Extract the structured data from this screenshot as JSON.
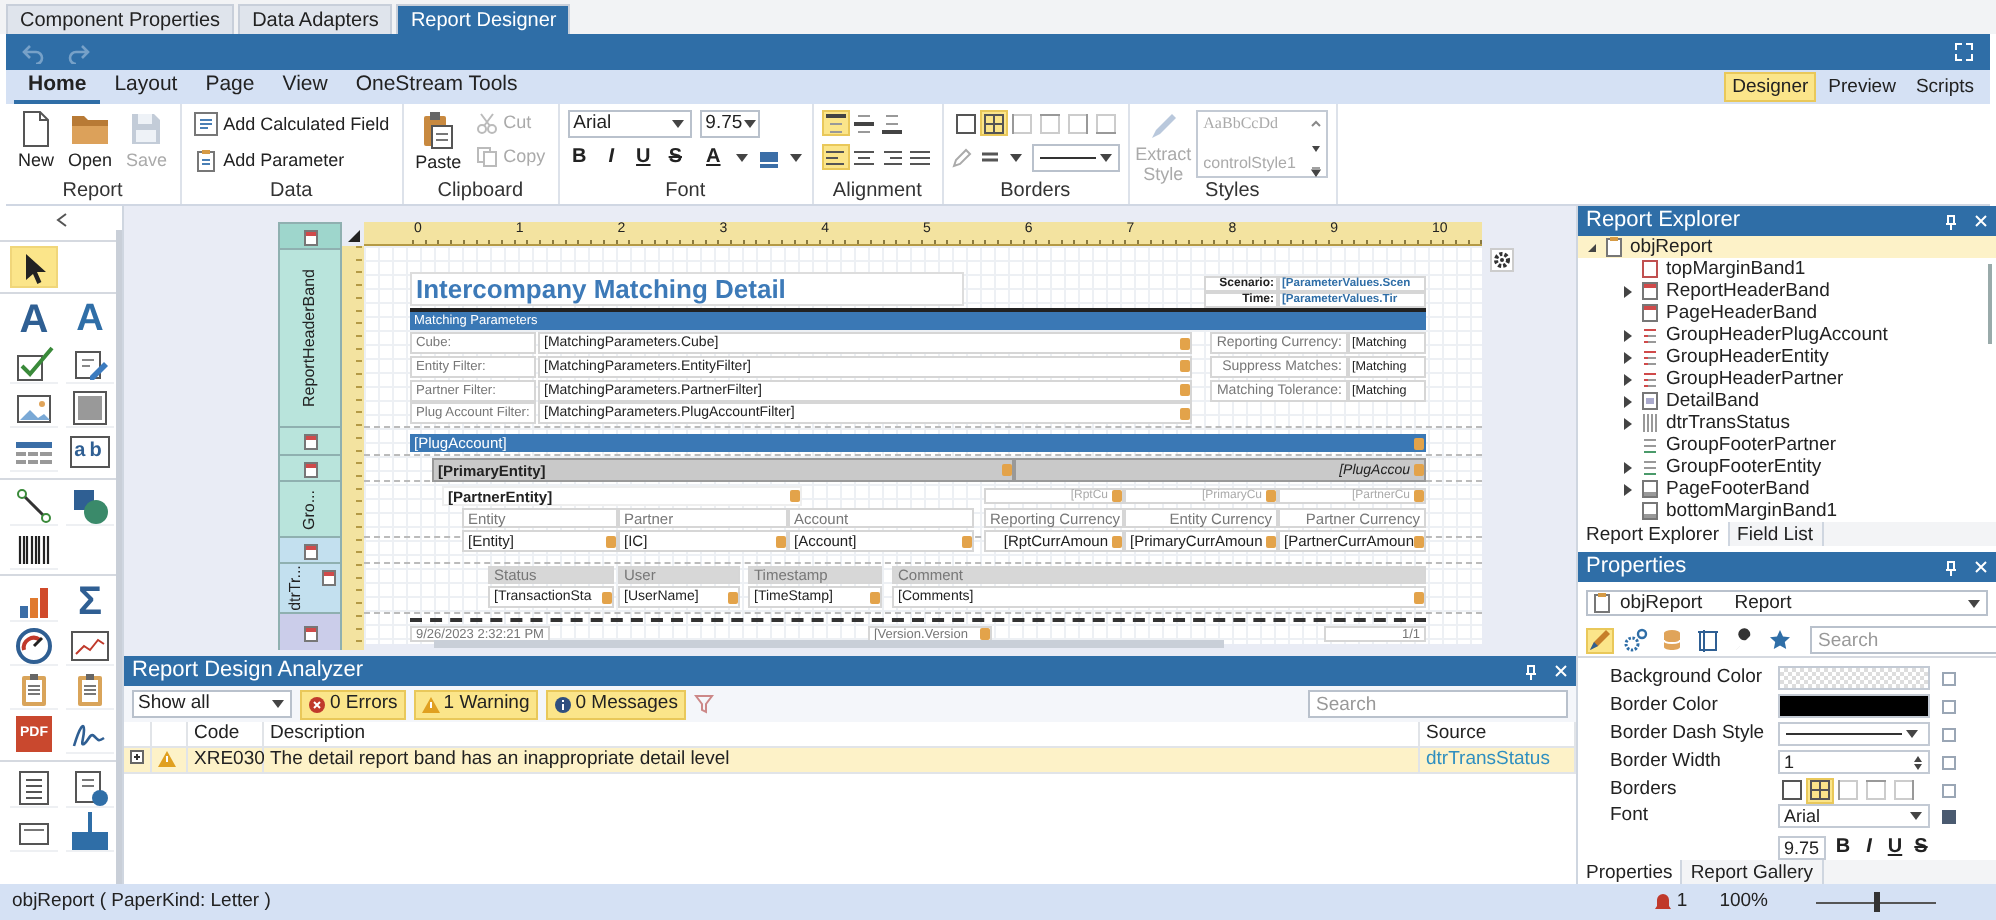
{
  "top_tabs": [
    {
      "label": "Component Properties",
      "selected": false
    },
    {
      "label": "Data Adapters",
      "selected": false
    },
    {
      "label": "Report Designer",
      "selected": true
    }
  ],
  "quick_access": [
    {
      "kind": "undo",
      "disabled": true
    },
    {
      "kind": "redo",
      "disabled": true
    }
  ],
  "ribbon": {
    "tabs": [
      {
        "label": "Home",
        "selected": true
      },
      {
        "label": "Layout",
        "selected": false
      },
      {
        "label": "Page",
        "selected": false
      },
      {
        "label": "View",
        "selected": false
      },
      {
        "label": "OneStream Tools",
        "selected": false
      }
    ],
    "modes": [
      {
        "label": "Designer",
        "selected": true
      },
      {
        "label": "Preview",
        "selected": false
      },
      {
        "label": "Scripts",
        "selected": false
      }
    ],
    "report_group": {
      "label": "Report",
      "buttons": [
        {
          "kind": "new",
          "label": "New",
          "disabled": false
        },
        {
          "kind": "open",
          "label": "Open",
          "disabled": false
        },
        {
          "kind": "save",
          "label": "Save",
          "disabled": true
        }
      ]
    },
    "data_group": {
      "label": "Data",
      "buttons": [
        {
          "kind": "calc",
          "label": "Add Calculated Field"
        },
        {
          "kind": "param",
          "label": "Add Parameter"
        }
      ]
    },
    "clipboard_group": {
      "label": "Clipboard",
      "paste": "Paste",
      "buttons": [
        {
          "kind": "cut",
          "label": "Cut",
          "disabled": true
        },
        {
          "kind": "copy",
          "label": "Copy",
          "disabled": true
        }
      ]
    },
    "font_group": {
      "label": "Font",
      "font": "Arial",
      "size": "9.75",
      "styles": [
        "B",
        "I",
        "U",
        "S"
      ],
      "color_glyph": "A"
    },
    "alignment_group": {
      "label": "Alignment",
      "rows": [
        [
          {
            "kind": "top",
            "selected": true
          },
          {
            "kind": "middle",
            "selected": false
          },
          {
            "kind": "bottom",
            "selected": false
          }
        ],
        [
          {
            "kind": "left",
            "selected": true
          },
          {
            "kind": "center",
            "selected": false
          },
          {
            "kind": "right",
            "selected": false
          },
          {
            "kind": "justify",
            "selected": false
          }
        ]
      ]
    },
    "borders_group": {
      "label": "Borders",
      "buttons": [
        {
          "kind": "none",
          "selected": false
        },
        {
          "kind": "all",
          "selected": true
        },
        {
          "kind": "left",
          "selected": false
        },
        {
          "kind": "top",
          "selected": false
        },
        {
          "kind": "right",
          "selected": false
        },
        {
          "kind": "bottom",
          "selected": false
        }
      ]
    },
    "styles_group": {
      "label": "Styles",
      "extract": {
        "label": "Extract Style",
        "disabled": true
      },
      "previews": [
        "AaBbCcDd",
        "controlStyle1"
      ]
    }
  },
  "toolbox": {
    "groups": [
      [
        {
          "kind": "pointer",
          "selected": true
        }
      ],
      [
        {
          "kind": "label",
          "glyph": "A",
          "selected": false
        },
        {
          "kind": "richtext",
          "glyph": "A",
          "selected": false
        },
        {
          "kind": "checkedit",
          "selected": false
        },
        {
          "kind": "edit",
          "selected": false
        },
        {
          "kind": "picture",
          "selected": false
        },
        {
          "kind": "panel",
          "selected": false
        },
        {
          "kind": "table",
          "selected": false
        },
        {
          "kind": "charbox",
          "glyph": "ab",
          "selected": false
        }
      ],
      [
        {
          "kind": "line",
          "selected": false
        },
        {
          "kind": "shape",
          "selected": false
        },
        {
          "kind": "barcode",
          "selected": false
        }
      ],
      [
        {
          "kind": "chart",
          "selected": false
        },
        {
          "kind": "sum",
          "glyph": "Σ",
          "selected": false
        },
        {
          "kind": "gauge",
          "selected": false
        },
        {
          "kind": "sparkline",
          "selected": false
        },
        {
          "kind": "subreport",
          "selected": false
        },
        {
          "kind": "subreport",
          "selected": false
        },
        {
          "kind": "pdf",
          "glyph": "PDF",
          "selected": false
        },
        {
          "kind": "signature",
          "selected": false
        }
      ],
      [
        {
          "kind": "toc",
          "selected": false
        },
        {
          "kind": "pageinfo",
          "selected": false
        },
        {
          "kind": "pagebreak",
          "selected": false
        },
        {
          "kind": "crossband",
          "selected": false
        }
      ]
    ]
  },
  "designer": {
    "ruler": [
      "0",
      "1",
      "2",
      "3",
      "4",
      "5",
      "6",
      "7",
      "8",
      "9",
      "10"
    ],
    "bands": [
      {
        "kind": "margin"
      },
      {
        "kind": "header",
        "label": "ReportHeaderBand"
      },
      {
        "kind": "group"
      },
      {
        "kind": "group"
      },
      {
        "kind": "group",
        "label": "Gro..."
      },
      {
        "kind": "detail"
      },
      {
        "kind": "detail-report",
        "label": "dtrTr..."
      },
      {
        "kind": "footer"
      }
    ],
    "report": {
      "title": "Intercompany Matching Detail",
      "header_fields": [
        {
          "label": "Scenario:",
          "value": "[ParameterValues.Scen"
        },
        {
          "label": "Time:",
          "value": "[ParameterValues.Tir"
        }
      ],
      "section_title": "Matching Parameters",
      "params_left": [
        {
          "label": "Cube:",
          "value": "[MatchingParameters.Cube]"
        },
        {
          "label": "Entity Filter:",
          "value": "[MatchingParameters.EntityFilter]"
        },
        {
          "label": "Partner Filter:",
          "value": "[MatchingParameters.PartnerFilter]"
        },
        {
          "label": "Plug Account Filter:",
          "value": "[MatchingParameters.PlugAccountFilter]"
        }
      ],
      "params_right": [
        {
          "label": "Reporting Currency:",
          "value": "[Matching"
        },
        {
          "label": "Suppress Matches:",
          "value": "[Matching"
        },
        {
          "label": "Matching Tolerance:",
          "value": "[Matching"
        }
      ],
      "plug_account": "[PlugAccount]",
      "primary_entity": "[PrimaryEntity]",
      "primary_right": "[PlugAccou",
      "partner_entity": "[PartnerEntity]",
      "group_totals": [
        "[RptCu",
        "[PrimaryCu",
        "[PartnerCu"
      ],
      "detail_headers": [
        "Entity",
        "Partner",
        "Account",
        "Reporting Currency",
        "Entity Currency",
        "Partner Currency"
      ],
      "detail_values": [
        "[Entity]",
        "[IC]",
        "[Account]",
        "[RptCurrAmoun",
        "[PrimaryCurrAmoun",
        "[PartnerCurrAmoun"
      ],
      "status_headers": [
        "Status",
        "User",
        "Timestamp",
        "Comment"
      ],
      "status_values": [
        "[TransactionSta",
        "[UserName]",
        "[TimeStamp]",
        "[Comments]"
      ],
      "footer": [
        "9/26/2023 2:32:21 PM",
        "[Version.Version",
        "1/1"
      ]
    }
  },
  "analyzer": {
    "title": "Report Design Analyzer",
    "filter": "Show all",
    "toggles": [
      {
        "kind": "error",
        "label": "0 Errors",
        "selected": true
      },
      {
        "kind": "warning",
        "label": "1 Warning",
        "selected": true
      },
      {
        "kind": "message",
        "label": "0 Messages",
        "selected": true
      }
    ],
    "search_placeholder": "Search",
    "columns": [
      "Code",
      "Description",
      "Source"
    ],
    "rows": [
      {
        "kind": "warning",
        "code": "XRE030",
        "description": "The detail report band has an inappropriate detail level",
        "source": "dtrTransStatus",
        "selected": true,
        "expanded": false
      }
    ]
  },
  "report_explorer": {
    "title": "Report Explorer",
    "tree": [
      {
        "label": "objReport",
        "kind": "report",
        "expanded": true,
        "selected": true,
        "children": [
          {
            "label": "topMarginBand1",
            "kind": "margin",
            "expandable": false,
            "selected": false
          },
          {
            "label": "ReportHeaderBand",
            "kind": "header",
            "expandable": true,
            "selected": false
          },
          {
            "label": "PageHeaderBand",
            "kind": "header",
            "expandable": false,
            "selected": false
          },
          {
            "label": "GroupHeaderPlugAccount",
            "kind": "group",
            "expandable": true,
            "selected": false
          },
          {
            "label": "GroupHeaderEntity",
            "kind": "group",
            "expandable": true,
            "selected": false
          },
          {
            "label": "GroupHeaderPartner",
            "kind": "group",
            "expandable": true,
            "selected": false
          },
          {
            "label": "DetailBand",
            "kind": "detail",
            "expandable": true,
            "selected": false
          },
          {
            "label": "dtrTransStatus",
            "kind": "detail-report",
            "expandable": true,
            "selected": false
          },
          {
            "label": "GroupFooterPartner",
            "kind": "group-footer",
            "expandable": false,
            "selected": false
          },
          {
            "label": "GroupFooterEntity",
            "kind": "group-footer",
            "expandable": true,
            "selected": false
          },
          {
            "label": "PageFooterBand",
            "kind": "footer",
            "expandable": true,
            "selected": false
          },
          {
            "label": "bottomMarginBand1",
            "kind": "footer",
            "expandable": false,
            "selected": false
          }
        ]
      }
    ],
    "tabs": [
      {
        "label": "Report Explorer",
        "selected": true
      },
      {
        "label": "Field List",
        "selected": false
      }
    ]
  },
  "properties": {
    "title": "Properties",
    "object": "objReport",
    "type": "Report",
    "tools": [
      {
        "kind": "appearance",
        "selected": true
      },
      {
        "kind": "behavior",
        "selected": false
      },
      {
        "kind": "data",
        "selected": false
      },
      {
        "kind": "layout",
        "selected": false
      },
      {
        "kind": "tools",
        "selected": false
      },
      {
        "kind": "favorites",
        "selected": false
      }
    ],
    "search_placeholder": "Search",
    "rows": [
      {
        "label": "Background Color",
        "kind": "transparent",
        "modified": false
      },
      {
        "label": "Border Color",
        "kind": "color",
        "color": "#000000",
        "modified": false
      },
      {
        "label": "Border Dash Style",
        "kind": "line",
        "modified": false
      },
      {
        "label": "Border Width",
        "kind": "number",
        "value": "1",
        "modified": false
      },
      {
        "label": "Borders",
        "kind": "borders",
        "modified": false
      },
      {
        "label": "Font",
        "kind": "font",
        "value": "Arial",
        "size": "9.75",
        "styles": [
          "B",
          "I",
          "U",
          "S"
        ],
        "modified": true
      }
    ],
    "tabs": [
      {
        "label": "Properties",
        "selected": true
      },
      {
        "label": "Report Gallery",
        "selected": false
      }
    ]
  },
  "status_bar": {
    "text": "objReport ( PaperKind: Letter )",
    "notifications": "1",
    "zoom": "100%",
    "zoom_slider": {
      "level": 0.5
    }
  }
}
